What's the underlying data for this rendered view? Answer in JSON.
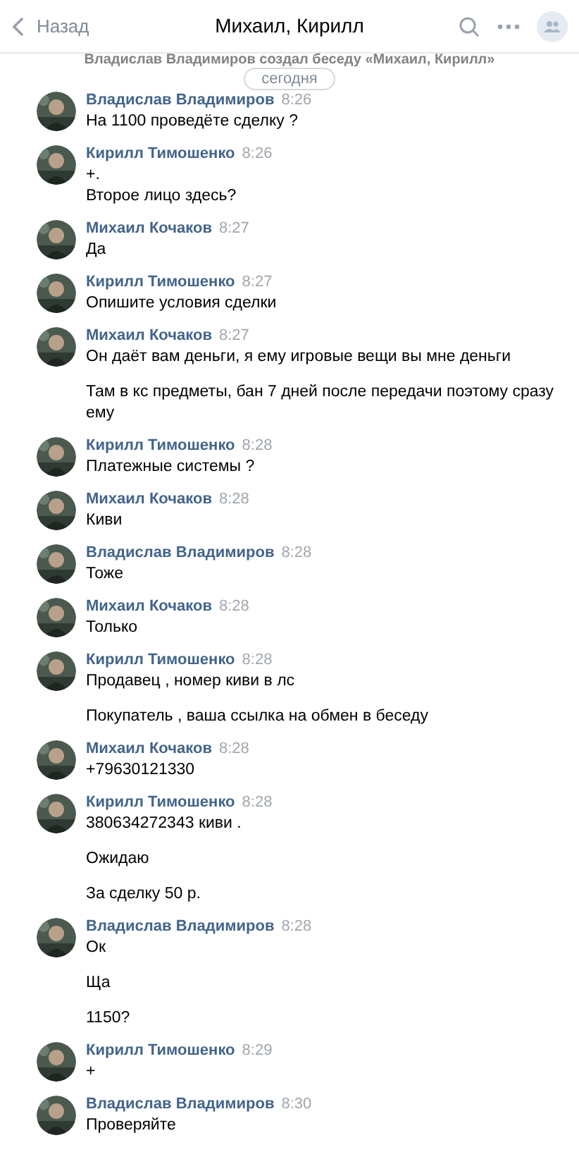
{
  "header": {
    "back": "Назад",
    "title": "Михаил, Кирилл"
  },
  "system_message": "Владислав Владимиров создал беседу «Михаил, Кирилл»",
  "date_pill": "сегодня",
  "messages": [
    {
      "author": "Владислав Владимиров",
      "time": "8:26",
      "paragraphs": [
        "На 1100 проведёте сделку ?"
      ]
    },
    {
      "author": "Кирилл Тимошенко",
      "time": "8:26",
      "paragraphs": [
        "+.\nВторое лицо здесь?"
      ]
    },
    {
      "author": "Михаил Кочаков",
      "time": "8:27",
      "paragraphs": [
        "Да"
      ]
    },
    {
      "author": "Кирилл Тимошенко",
      "time": "8:27",
      "paragraphs": [
        "Опишите условия сделки"
      ]
    },
    {
      "author": "Михаил Кочаков",
      "time": "8:27",
      "paragraphs": [
        "Он даёт вам деньги, я ему игровые вещи вы мне деньги",
        "Там в кс предметы, бан 7 дней после передачи поэтому сразу ему"
      ]
    },
    {
      "author": "Кирилл Тимошенко",
      "time": "8:28",
      "paragraphs": [
        "Платежные системы ?"
      ]
    },
    {
      "author": "Михаил Кочаков",
      "time": "8:28",
      "paragraphs": [
        "Киви"
      ]
    },
    {
      "author": "Владислав Владимиров",
      "time": "8:28",
      "paragraphs": [
        "Тоже"
      ]
    },
    {
      "author": "Михаил Кочаков",
      "time": "8:28",
      "paragraphs": [
        "Только"
      ]
    },
    {
      "author": "Кирилл Тимошенко",
      "time": "8:28",
      "paragraphs": [
        "Продавец , номер киви в лс",
        "Покупатель , ваша ссылка на обмен в беседу"
      ]
    },
    {
      "author": "Михаил Кочаков",
      "time": "8:28",
      "paragraphs": [
        "+79630121330"
      ]
    },
    {
      "author": "Кирилл Тимошенко",
      "time": "8:28",
      "paragraphs": [
        "380634272343 киви .",
        "Ожидаю",
        "За сделку 50 р."
      ]
    },
    {
      "author": "Владислав Владимиров",
      "time": "8:28",
      "paragraphs": [
        "Ок",
        "Ща",
        "1150?"
      ]
    },
    {
      "author": "Кирилл Тимошенко",
      "time": "8:29",
      "paragraphs": [
        "+"
      ]
    },
    {
      "author": "Владислав Владимиров",
      "time": "8:30",
      "paragraphs": [
        "Проверяйте"
      ]
    }
  ]
}
